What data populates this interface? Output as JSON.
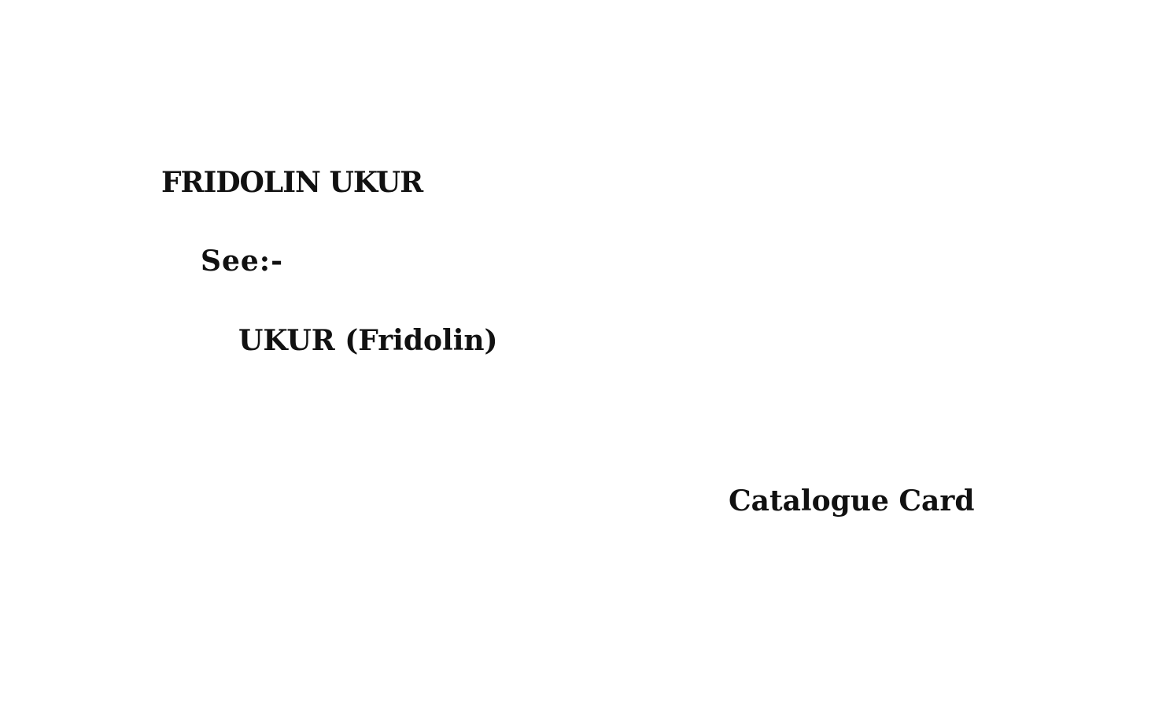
{
  "card": {
    "heading": "FRIDOLIN UKUR",
    "see_label": "See:-",
    "reference": "UKUR (Fridolin)",
    "footer_label": "Catalogue Card"
  }
}
